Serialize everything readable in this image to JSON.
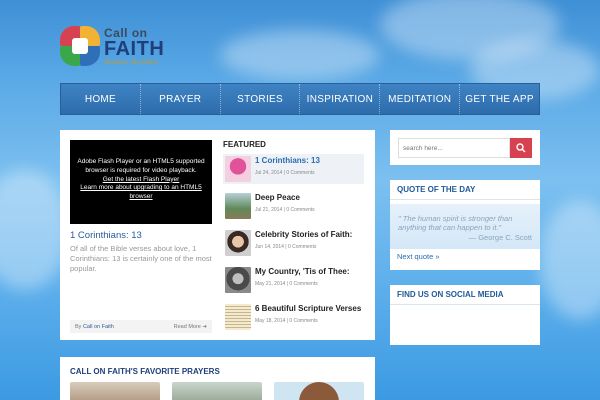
{
  "brand": {
    "line1": "Call on",
    "line2": "FAITH",
    "tagline": "Anytime. Anywhere.",
    "colors": [
      "#d6424f",
      "#f2b233",
      "#3aa84a",
      "#2e6fb8"
    ]
  },
  "nav": {
    "items": [
      "HOME",
      "PRAYER",
      "STORIES",
      "INSPIRATION",
      "MEDITATION",
      "GET THE APP"
    ]
  },
  "video": {
    "line1": "Adobe Flash Player or an HTML5 supported browser is required for video playback.",
    "link1": "Get the latest Flash Player",
    "link2": "Learn more about upgrading to an HTML5 browser"
  },
  "post": {
    "title": "1 Corinthians: 13",
    "excerpt": "Of all of the Bible verses about love, 1 Corinthians: 13 is certainly one of the most popular.",
    "byline_prefix": "By",
    "author": "Call on Faith",
    "read_more": "Read More"
  },
  "featured": {
    "label": "FEATURED",
    "items": [
      {
        "title": "1 Corinthians: 13",
        "meta": "Jul 24, 2014 | 0 Comments"
      },
      {
        "title": "Deep Peace",
        "meta": "Jul 21, 2014 | 0 Comments"
      },
      {
        "title": "Celebrity Stories of Faith:",
        "meta": "Jun 14, 2014 | 0 Comments"
      },
      {
        "title": "My Country, 'Tis of Thee:",
        "meta": "May 21, 2014 | 0 Comments"
      },
      {
        "title": "6 Beautiful Scripture Verses",
        "meta": "May 18, 2014 | 0 Comments"
      }
    ]
  },
  "search": {
    "placeholder": "search here..."
  },
  "quote": {
    "title": "QUOTE OF THE DAY",
    "text": "\" The human spirit is stronger than anything that can happen to it.\"",
    "author": "— George C. Scott",
    "next": "Next quote »"
  },
  "social": {
    "title": "FIND US ON SOCIAL MEDIA"
  },
  "prayers": {
    "title": "CALL ON FAITH'S FAVORITE PRAYERS"
  }
}
